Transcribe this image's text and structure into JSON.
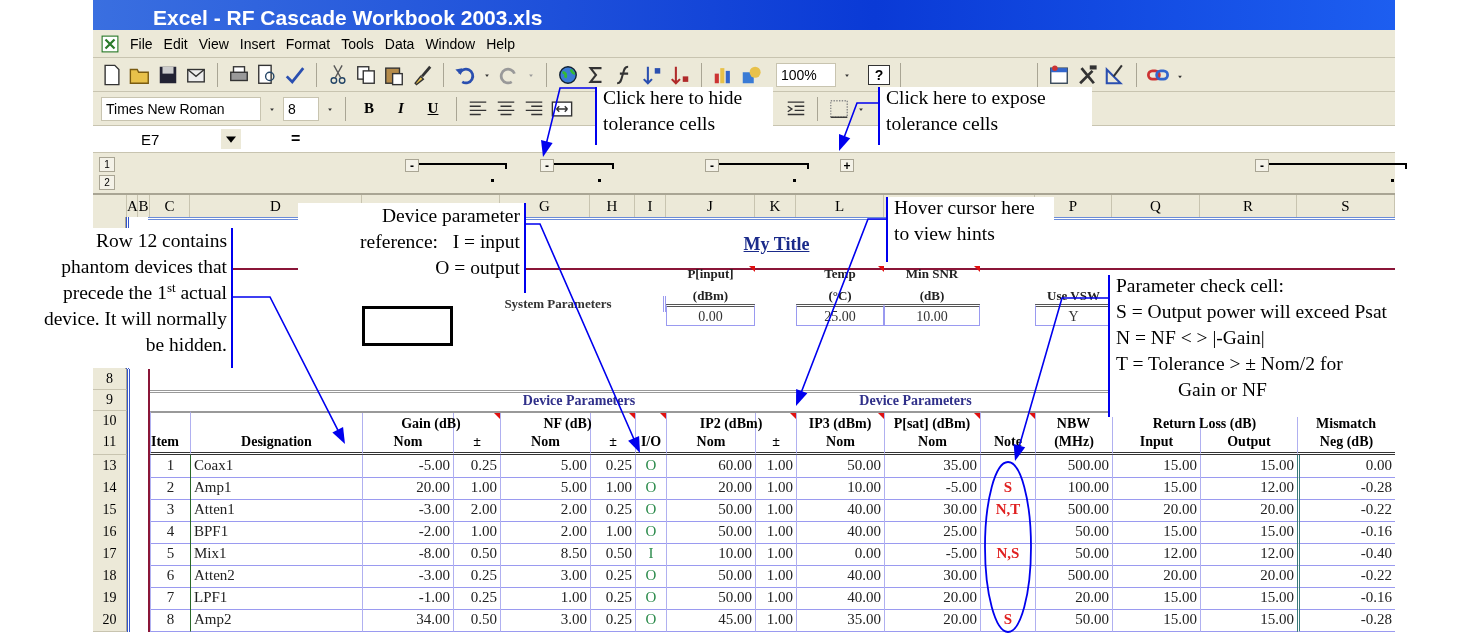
{
  "window": {
    "title": "Excel - RF Cascade Workbook 2003.xls"
  },
  "menu": [
    "File",
    "Edit",
    "View",
    "Insert",
    "Format",
    "Tools",
    "Data",
    "Window",
    "Help"
  ],
  "standard_toolbar": {
    "zoom": "100%",
    "help": "?"
  },
  "formatting_toolbar": {
    "font": "Times New Roman",
    "size": "8",
    "style_buttons": [
      "B",
      "I",
      "U"
    ]
  },
  "formula_bar": {
    "cell": "E7",
    "equals": "="
  },
  "outline": {
    "levels": [
      "1",
      "2"
    ],
    "groups": [
      {
        "symbol": "-",
        "expanded": true
      },
      {
        "symbol": "-",
        "expanded": true
      },
      {
        "symbol": "-",
        "expanded": true
      },
      {
        "symbol": "+",
        "expanded": false
      },
      {
        "symbol": "-",
        "expanded": true
      }
    ]
  },
  "column_headers": [
    "A",
    "B",
    "C",
    "D",
    "G",
    "H",
    "I",
    "J",
    "K",
    "L",
    "P",
    "Q",
    "R",
    "S"
  ],
  "sheet": {
    "title": "My Title",
    "system_parameters": {
      "label": "System Parameters",
      "params": [
        {
          "name": "P[input]",
          "unit": "(dBm)",
          "value": "0.00",
          "comment": true
        },
        {
          "name": "Temp",
          "unit": "(°C)",
          "value": "25.00",
          "comment": true
        },
        {
          "name": "Min SNR",
          "unit": "(dB)",
          "value": "10.00",
          "comment": true
        },
        {
          "name": "Use VSW",
          "value": "Y",
          "comment": false
        }
      ]
    },
    "row_labels": [
      "8",
      "9",
      "10",
      "11"
    ],
    "group_headings": [
      "Device Parameters",
      "Device Parameters"
    ],
    "header_groups": [
      "Gain (dB)",
      "NF (dB)",
      "IP2 (dBm)",
      "IP3 (dBm)",
      "P[sat] (dBm)",
      "NBW",
      "Return Loss (dB)",
      "Mismatch"
    ],
    "columns": [
      {
        "label": "Item",
        "comment": false
      },
      {
        "label": "Designation",
        "comment": false
      },
      {
        "label": "Nom",
        "comment": false
      },
      {
        "label": "±",
        "comment": true
      },
      {
        "label": "Nom",
        "comment": false
      },
      {
        "label": "±",
        "comment": true
      },
      {
        "label": "I/O",
        "comment": true
      },
      {
        "label": "Nom",
        "comment": false
      },
      {
        "label": "±",
        "comment": true
      },
      {
        "label": "Nom",
        "comment": true
      },
      {
        "label": "Nom",
        "comment": true
      },
      {
        "label": "Note",
        "comment": true
      },
      {
        "label": "(MHz)",
        "comment": false
      },
      {
        "label": "Input",
        "comment": false
      },
      {
        "label": "Output",
        "comment": false
      },
      {
        "label": "Neg (dB)",
        "comment": false
      }
    ],
    "rows": [
      {
        "row": "13",
        "cells": [
          "1",
          "Coax1",
          "-5.00",
          "0.25",
          "5.00",
          "0.25",
          "O",
          "60.00",
          "1.00",
          "50.00",
          "35.00",
          "500.00",
          "15.00",
          "15.00",
          "0.00"
        ]
      },
      {
        "row": "14",
        "cells": [
          "2",
          "Amp1",
          "20.00",
          "1.00",
          "5.00",
          "1.00",
          "O",
          "20.00",
          "1.00",
          "10.00",
          "-5.00",
          "100.00",
          "15.00",
          "12.00",
          "-0.28"
        ],
        "note": "S"
      },
      {
        "row": "15",
        "cells": [
          "3",
          "Atten1",
          "-3.00",
          "2.00",
          "2.00",
          "0.25",
          "O",
          "50.00",
          "1.00",
          "40.00",
          "30.00",
          "500.00",
          "20.00",
          "20.00",
          "-0.22"
        ],
        "note": "N,T"
      },
      {
        "row": "16",
        "cells": [
          "4",
          "BPF1",
          "-2.00",
          "1.00",
          "2.00",
          "1.00",
          "O",
          "50.00",
          "1.00",
          "40.00",
          "25.00",
          "50.00",
          "15.00",
          "15.00",
          "-0.16"
        ]
      },
      {
        "row": "17",
        "cells": [
          "5",
          "Mix1",
          "-8.00",
          "0.50",
          "8.50",
          "0.50",
          "I",
          "10.00",
          "1.00",
          "0.00",
          "-5.00",
          "50.00",
          "12.00",
          "12.00",
          "-0.40"
        ],
        "note": "N,S"
      },
      {
        "row": "18",
        "cells": [
          "6",
          "Atten2",
          "-3.00",
          "0.25",
          "3.00",
          "0.25",
          "O",
          "50.00",
          "1.00",
          "40.00",
          "30.00",
          "500.00",
          "20.00",
          "20.00",
          "-0.22"
        ]
      },
      {
        "row": "19",
        "cells": [
          "7",
          "LPF1",
          "-1.00",
          "0.25",
          "1.00",
          "0.25",
          "O",
          "50.00",
          "1.00",
          "40.00",
          "20.00",
          "20.00",
          "15.00",
          "15.00",
          "-0.16"
        ]
      },
      {
        "row": "20",
        "cells": [
          "8",
          "Amp2",
          "34.00",
          "0.50",
          "3.00",
          "0.25",
          "O",
          "45.00",
          "1.00",
          "35.00",
          "20.00",
          "50.00",
          "15.00",
          "15.00",
          "-0.28"
        ],
        "note": "S"
      }
    ]
  },
  "callouts": [
    {
      "lines": [
        "Click here to hide",
        "tolerance cells"
      ]
    },
    {
      "lines": [
        "Click here to expose",
        "tolerance cells"
      ]
    },
    {
      "lines": [
        "Device parameter",
        "reference:   I = input",
        "O = output"
      ]
    },
    {
      "lines": [
        "Hover cursor here",
        "to view hints"
      ]
    },
    {
      "lines": [
        "Row 12 contains",
        "phantom devices that",
        "precede the 1$^{st}$ actual",
        "device. It will normally",
        "be hidden."
      ]
    },
    {
      "lines": [
        "Parameter check cell:",
        "S = Output power will exceed Psat",
        "N = NF < > |-Gain|",
        "T = Tolerance > ± Nom/2 for",
        "Gain or NF"
      ]
    }
  ]
}
